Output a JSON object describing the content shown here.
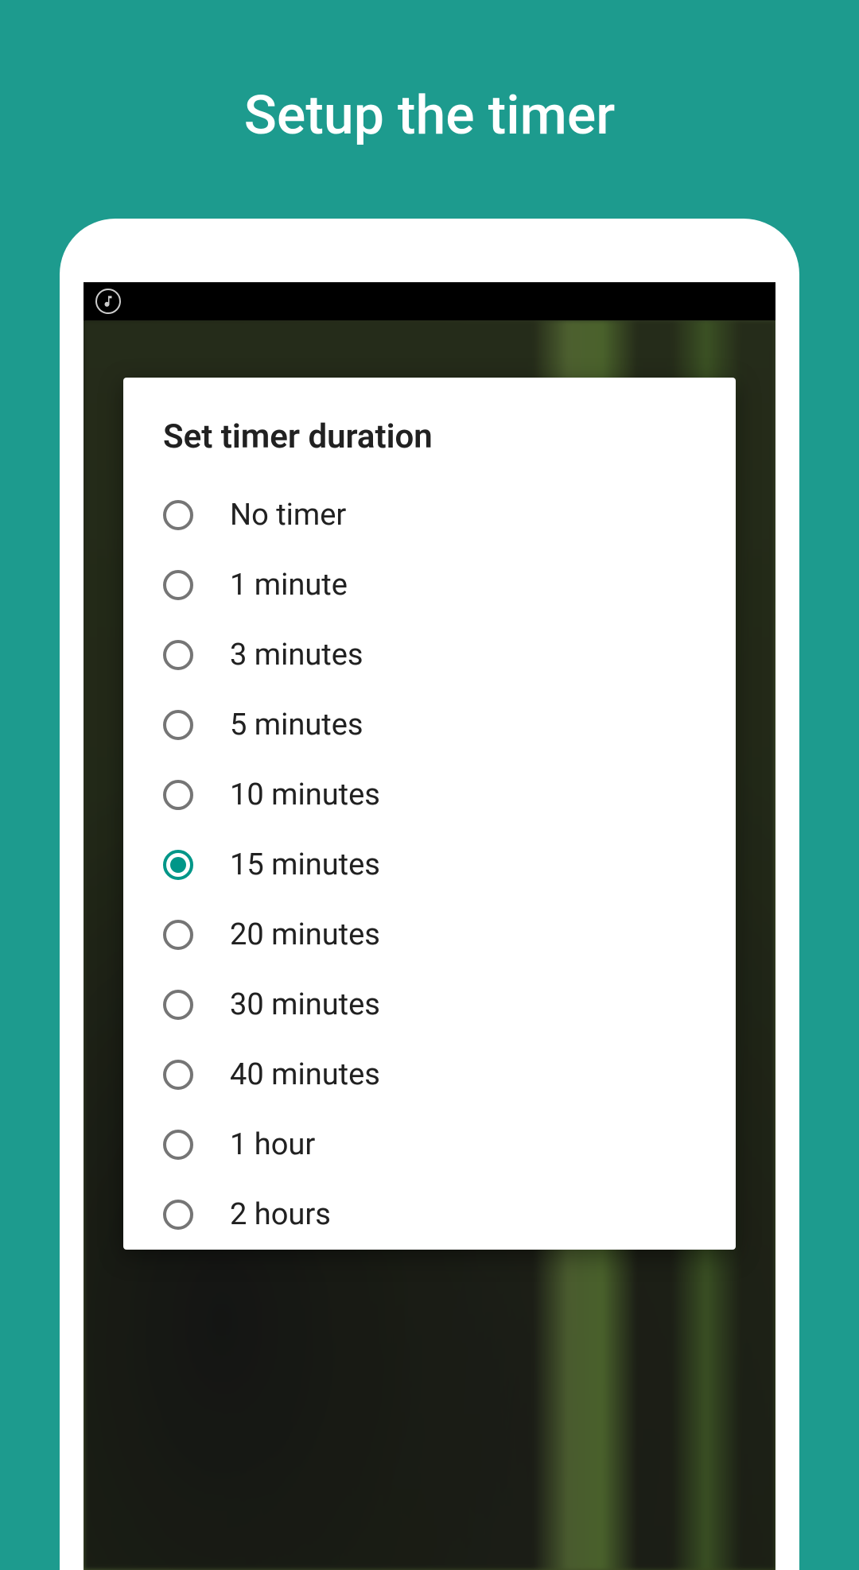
{
  "header": {
    "title": "Setup the timer"
  },
  "dialog": {
    "title": "Set timer duration",
    "selected_index": 5,
    "options": [
      "No timer",
      "1 minute",
      "3 minutes",
      "5 minutes",
      "10 minutes",
      "15 minutes",
      "20 minutes",
      "30 minutes",
      "40 minutes",
      "1 hour",
      "2 hours"
    ]
  }
}
